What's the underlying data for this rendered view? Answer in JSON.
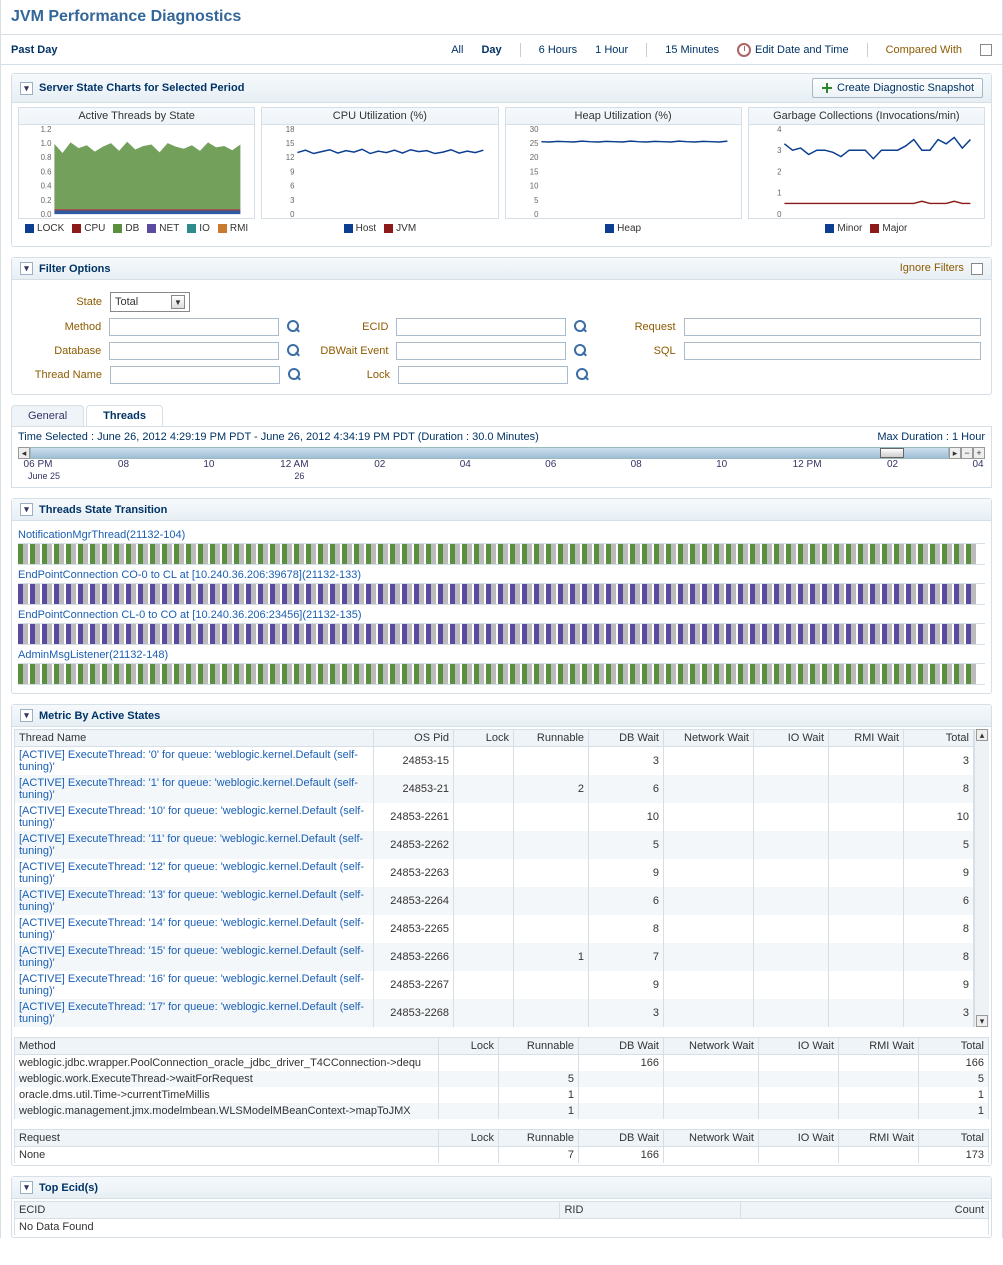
{
  "page_title": "JVM Performance Diagnostics",
  "toolbar": {
    "range_label": "Past Day",
    "links": {
      "all": "All",
      "day": "Day",
      "h6": "6 Hours",
      "h1": "1 Hour",
      "m15": "15 Minutes"
    },
    "edit": "Edit Date and Time",
    "compare_label": "Compared With",
    "compared_checked": false
  },
  "charts_panel": {
    "title": "Server State Charts for Selected Period",
    "create_btn": "Create Diagnostic Snapshot",
    "charts": [
      {
        "title": "Active Threads by State",
        "legend": [
          [
            "#0b3d91",
            "LOCK"
          ],
          [
            "#8b1a1a",
            "CPU"
          ],
          [
            "#5a8f3d",
            "DB"
          ],
          [
            "#5a4aa0",
            "NET"
          ],
          [
            "#2e8b8b",
            "IO"
          ],
          [
            "#c97a2e",
            "RMI"
          ]
        ]
      },
      {
        "title": "CPU Utilization (%)",
        "legend": [
          [
            "#0b3d91",
            "Host"
          ],
          [
            "#8b1a1a",
            "JVM"
          ]
        ]
      },
      {
        "title": "Heap Utilization (%)",
        "legend": [
          [
            "#0b3d91",
            "Heap"
          ]
        ]
      },
      {
        "title": "Garbage Collections (Invocations/min)",
        "legend": [
          [
            "#0b3d91",
            "Minor"
          ],
          [
            "#8b1a1a",
            "Major"
          ]
        ]
      }
    ]
  },
  "chart_data": [
    {
      "type": "area",
      "title": "Active Threads by State",
      "ylim": [
        0,
        1.2
      ],
      "yticks": [
        0.0,
        0.2,
        0.4,
        0.6,
        0.8,
        1.0,
        1.2
      ],
      "series": [
        {
          "name": "LOCK",
          "values": [
            0.05,
            0.05,
            0.05,
            0.05,
            0.05,
            0.05,
            0.05,
            0.05,
            0.05,
            0.05,
            0.05,
            0.05,
            0.05,
            0.05,
            0.05,
            0.05,
            0.05,
            0.05,
            0.05,
            0.05,
            0.05,
            0.05,
            0.05,
            0.05
          ]
        },
        {
          "name": "CPU",
          "values": [
            0.02,
            0.02,
            0.02,
            0.02,
            0.02,
            0.02,
            0.02,
            0.02,
            0.02,
            0.02,
            0.02,
            0.02,
            0.02,
            0.02,
            0.02,
            0.02,
            0.02,
            0.02,
            0.02,
            0.02,
            0.02,
            0.02,
            0.02,
            0.02
          ]
        },
        {
          "name": "DB",
          "values": [
            0.92,
            0.79,
            0.94,
            0.86,
            0.9,
            0.81,
            0.88,
            0.93,
            0.82,
            0.95,
            0.84,
            0.89,
            0.91,
            0.8,
            0.93,
            0.88,
            0.85,
            0.9,
            0.82,
            0.94,
            0.87,
            0.89,
            0.83,
            0.91
          ]
        },
        {
          "name": "NET",
          "values": [
            0,
            0,
            0,
            0,
            0,
            0,
            0,
            0,
            0,
            0,
            0,
            0,
            0,
            0,
            0,
            0,
            0,
            0,
            0,
            0,
            0,
            0,
            0,
            0
          ]
        },
        {
          "name": "IO",
          "values": [
            0,
            0,
            0,
            0,
            0,
            0,
            0,
            0,
            0,
            0,
            0,
            0,
            0,
            0,
            0,
            0,
            0,
            0,
            0,
            0,
            0,
            0,
            0,
            0
          ]
        },
        {
          "name": "RMI",
          "values": [
            0,
            0,
            0,
            0,
            0,
            0,
            0,
            0,
            0,
            0,
            0,
            0,
            0,
            0,
            0,
            0,
            0,
            0,
            0,
            0,
            0,
            0,
            0,
            0
          ]
        }
      ]
    },
    {
      "type": "line",
      "title": "CPU Utilization (%)",
      "ylim": [
        0,
        18
      ],
      "yticks": [
        0,
        3,
        6,
        9,
        12,
        15,
        18
      ],
      "series": [
        {
          "name": "Host",
          "values": [
            13,
            13.5,
            12.8,
            13.2,
            13.6,
            12.9,
            13.4,
            13.1,
            13.7,
            12.8,
            13.3,
            13.0,
            13.5,
            12.9,
            13.6,
            13.2,
            13.4,
            12.8,
            13.1,
            13.6,
            12.9,
            13.3,
            13.0,
            13.5
          ]
        }
      ]
    },
    {
      "type": "line",
      "title": "Heap Utilization (%)",
      "ylim": [
        0,
        30
      ],
      "yticks": [
        0,
        5,
        10,
        15,
        20,
        25,
        30
      ],
      "series": [
        {
          "name": "Heap",
          "values": [
            25.5,
            25.4,
            25.6,
            25.5,
            25.4,
            25.7,
            25.5,
            25.4,
            25.6,
            25.5,
            25.4,
            25.7,
            25.5,
            25.4,
            25.6,
            25.5,
            25.4,
            25.7,
            25.5,
            25.4,
            25.6,
            25.5,
            25.4,
            25.7
          ]
        }
      ]
    },
    {
      "type": "line",
      "title": "Garbage Collections (Invocations/min)",
      "ylim": [
        0,
        4.0
      ],
      "yticks": [
        0,
        1.0,
        2.0,
        3.0,
        4.0
      ],
      "series": [
        {
          "name": "Minor",
          "values": [
            3.3,
            3.0,
            3.1,
            2.8,
            3.0,
            3.0,
            2.9,
            2.7,
            3.0,
            3.0,
            3.0,
            2.6,
            3.0,
            3.0,
            3.0,
            3.2,
            3.5,
            3.0,
            3.0,
            3.5,
            3.3,
            3.6,
            3.1,
            3.5
          ]
        },
        {
          "name": "Major",
          "values": [
            0.5,
            0.5,
            0.5,
            0.5,
            0.5,
            0.5,
            0.5,
            0.5,
            0.5,
            0.5,
            0.5,
            0.5,
            0.5,
            0.5,
            0.5,
            0.5,
            0.5,
            0.6,
            0.5,
            0.5,
            0.5,
            0.6,
            0.5,
            0.5
          ]
        }
      ]
    }
  ],
  "filters": {
    "title": "Filter Options",
    "ignore": "Ignore Filters",
    "rows": [
      [
        {
          "label": "State",
          "type": "select",
          "value": "Total"
        }
      ],
      [
        {
          "label": "Method",
          "type": "search"
        },
        {
          "label": "ECID",
          "type": "search"
        },
        {
          "label": "Request",
          "type": "text"
        }
      ],
      [
        {
          "label": "Database",
          "type": "search"
        },
        {
          "label": "DBWait Event",
          "type": "search"
        },
        {
          "label": "SQL",
          "type": "text"
        }
      ],
      [
        {
          "label": "Thread Name",
          "type": "search"
        },
        {
          "label": "Lock",
          "type": "search"
        }
      ]
    ]
  },
  "tabs": {
    "items": [
      "General",
      "Threads"
    ],
    "active": 1
  },
  "time_selected": "Time Selected : June 26, 2012 4:29:19 PM PDT - June 26, 2012 4:34:19 PM PDT  (Duration : 30.0 Minutes)",
  "max_duration": "Max Duration : 1 Hour",
  "timeline": {
    "ticks": [
      "06 PM",
      "08",
      "10",
      "12 AM",
      "02",
      "04",
      "06",
      "08",
      "10",
      "12 PM",
      "02",
      "04"
    ],
    "day0": "June 25",
    "day1": "26"
  },
  "threads_panel": {
    "title": "Threads State Transition",
    "threads": [
      {
        "name": "NotificationMgrThread(21132-104)",
        "pattern": "green"
      },
      {
        "name": "EndPointConnection CO-0 to CL at [10.240.36.206:39678](21132-133)",
        "pattern": "purple"
      },
      {
        "name": "EndPointConnection CL-0 to CO at [10.240.36.206:23456](21132-135)",
        "pattern": "purple"
      },
      {
        "name": "AdminMsgListener(21132-148)",
        "pattern": "green"
      }
    ]
  },
  "metric": {
    "title": "Metric By Active States",
    "cols": [
      "Thread Name",
      "OS Pid",
      "Lock",
      "Runnable",
      "DB Wait",
      "Network Wait",
      "IO Wait",
      "RMI Wait",
      "Total"
    ],
    "rows": [
      [
        "[ACTIVE] ExecuteThread: '0' for queue: 'weblogic.kernel.Default (self-tuning)'",
        "24853-15",
        "",
        "",
        "3",
        "",
        "",
        "",
        "3"
      ],
      [
        "[ACTIVE] ExecuteThread: '1' for queue: 'weblogic.kernel.Default (self-tuning)'",
        "24853-21",
        "",
        "2",
        "6",
        "",
        "",
        "",
        "8"
      ],
      [
        "[ACTIVE] ExecuteThread: '10' for queue: 'weblogic.kernel.Default (self-tuning)'",
        "24853-2261",
        "",
        "",
        "10",
        "",
        "",
        "",
        "10"
      ],
      [
        "[ACTIVE] ExecuteThread: '11' for queue: 'weblogic.kernel.Default (self-tuning)'",
        "24853-2262",
        "",
        "",
        "5",
        "",
        "",
        "",
        "5"
      ],
      [
        "[ACTIVE] ExecuteThread: '12' for queue: 'weblogic.kernel.Default (self-tuning)'",
        "24853-2263",
        "",
        "",
        "9",
        "",
        "",
        "",
        "9"
      ],
      [
        "[ACTIVE] ExecuteThread: '13' for queue: 'weblogic.kernel.Default (self-tuning)'",
        "24853-2264",
        "",
        "",
        "6",
        "",
        "",
        "",
        "6"
      ],
      [
        "[ACTIVE] ExecuteThread: '14' for queue: 'weblogic.kernel.Default (self-tuning)'",
        "24853-2265",
        "",
        "",
        "8",
        "",
        "",
        "",
        "8"
      ],
      [
        "[ACTIVE] ExecuteThread: '15' for queue: 'weblogic.kernel.Default (self-tuning)'",
        "24853-2266",
        "",
        "1",
        "7",
        "",
        "",
        "",
        "8"
      ],
      [
        "[ACTIVE] ExecuteThread: '16' for queue: 'weblogic.kernel.Default (self-tuning)'",
        "24853-2267",
        "",
        "",
        "9",
        "",
        "",
        "",
        "9"
      ],
      [
        "[ACTIVE] ExecuteThread: '17' for queue: 'weblogic.kernel.Default (self-tuning)'",
        "24853-2268",
        "",
        "",
        "3",
        "",
        "",
        "",
        "3"
      ]
    ],
    "method_cols": [
      "Method",
      "Lock",
      "Runnable",
      "DB Wait",
      "Network Wait",
      "IO Wait",
      "RMI Wait",
      "Total"
    ],
    "method_rows": [
      [
        "weblogic.jdbc.wrapper.PoolConnection_oracle_jdbc_driver_T4CConnection->dequ",
        "",
        "",
        "166",
        "",
        "",
        "",
        "166"
      ],
      [
        "weblogic.work.ExecuteThread->waitForRequest",
        "",
        "5",
        "",
        "",
        "",
        "",
        "5"
      ],
      [
        "oracle.dms.util.Time->currentTimeMillis",
        "",
        "1",
        "",
        "",
        "",
        "",
        "1"
      ],
      [
        "weblogic.management.jmx.modelmbean.WLSModelMBeanContext->mapToJMX",
        "",
        "1",
        "",
        "",
        "",
        "",
        "1"
      ]
    ],
    "request_cols": [
      "Request",
      "Lock",
      "Runnable",
      "DB Wait",
      "Network Wait",
      "IO Wait",
      "RMI Wait",
      "Total"
    ],
    "request_rows": [
      [
        "None",
        "",
        "7",
        "166",
        "",
        "",
        "",
        "173"
      ]
    ]
  },
  "top_ecid": {
    "title": "Top Ecid(s)",
    "cols": [
      "ECID",
      "RID",
      "Count"
    ],
    "empty": "No Data Found"
  }
}
